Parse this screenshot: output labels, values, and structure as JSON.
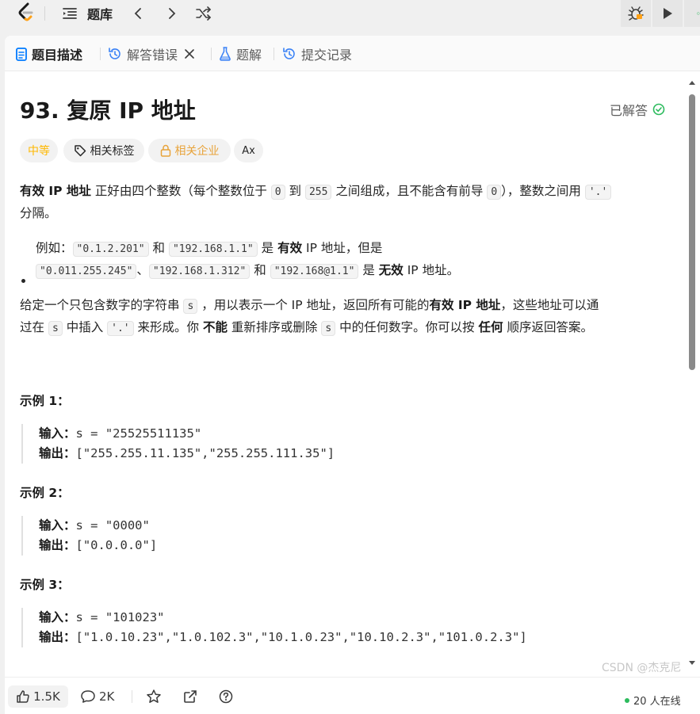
{
  "topbar": {
    "title": "题库",
    "list_icon": "list-icon",
    "prev_icon": "chevron-left-icon",
    "next_icon": "chevron-right-icon",
    "shuffle_icon": "shuffle-icon",
    "debug_icon": "bug-icon",
    "run_icon": "play-icon"
  },
  "tabs": [
    {
      "label": "题目描述",
      "icon": "description-icon",
      "active": true
    },
    {
      "label": "解答错误",
      "icon": "history-icon",
      "closable": true
    },
    {
      "label": "题解",
      "icon": "flask-icon"
    },
    {
      "label": "提交记录",
      "icon": "history-icon"
    }
  ],
  "question": {
    "title": "93. 复原 IP 地址",
    "status": "已解答",
    "difficulty": "中等",
    "tags_label": "相关标签",
    "companies_label": "相关企业",
    "translate_label": "Ax"
  },
  "desc": {
    "p1": {
      "b1": "有效 IP 地址",
      "t1": " 正好由四个整数（每个整数位于 ",
      "c1": "0",
      "t2": " 到 ",
      "c2": "255",
      "t3": " 之间组成，且不能含有前导 ",
      "c3": "0",
      "t4": "），整数之间用 ",
      "c4": "'.'",
      "t5": "分隔。"
    },
    "p2": {
      "t1": "例如：",
      "c1": "\"0.1.2.201\"",
      "t2": " 和 ",
      "c2": "\"192.168.1.1\"",
      "t3": " 是 ",
      "b1": "有效",
      "t4": " IP 地址，但是",
      "c3": "\"0.011.255.245\"",
      "t5": "、",
      "c4": "\"192.168.1.312\"",
      "t6": " 和 ",
      "c5": "\"192.168@1.1\"",
      "t7": " 是 ",
      "b2": "无效",
      "t8": " IP 地址。"
    },
    "p3": {
      "t1": "给定一个只包含数字的字符串 ",
      "c1": "s",
      "t2": " ，用以表示一个 IP 地址，返回所有可能的",
      "b1": "有效 IP 地址",
      "t3": "，这些地址可以通",
      "t4": "过在 ",
      "c2": "s",
      "t5": " 中插入 ",
      "c3": "'.'",
      "t6": " 来形成。你 ",
      "b2": "不能",
      "t7": " 重新排序或删除 ",
      "c4": "s",
      "t8": " 中的任何数字。你可以按 ",
      "b3": "任何",
      "t9": " 顺序返回答案。"
    }
  },
  "examples": [
    {
      "title": "示例 1：",
      "input_label": "输入：",
      "input": "s = \"25525511135\"",
      "output_label": "输出：",
      "output": "[\"255.255.11.135\",\"255.255.111.35\"]"
    },
    {
      "title": "示例 2：",
      "input_label": "输入：",
      "input": "s = \"0000\"",
      "output_label": "输出：",
      "output": "[\"0.0.0.0\"]"
    },
    {
      "title": "示例 3：",
      "input_label": "输入：",
      "input": "s = \"101023\"",
      "output_label": "输出：",
      "output": "[\"1.0.10.23\",\"1.0.102.3\",\"10.1.0.23\",\"10.10.2.3\",\"101.0.2.3\"]"
    }
  ],
  "footer": {
    "likes": "1.5K",
    "comments": "2K",
    "online": "20 人在线"
  },
  "watermark": "CSDN @杰克尼",
  "colors": {
    "accent_orange": "#ffa116",
    "easy_medium": "#ffb800",
    "success_green": "#2cbb5d",
    "active_tab_blue": "#007aff"
  }
}
